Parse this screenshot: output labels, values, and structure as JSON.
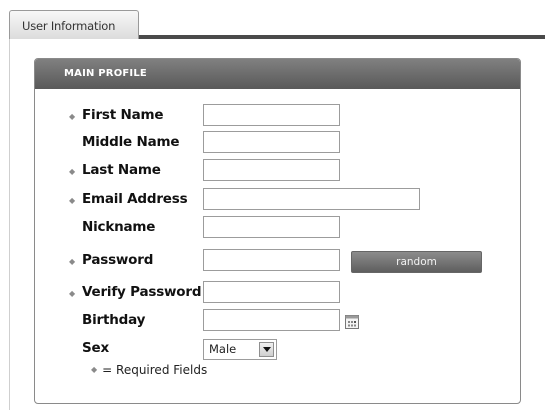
{
  "tabs": [
    {
      "label": "User Information"
    }
  ],
  "panel": {
    "title": "MAIN PROFILE"
  },
  "form": {
    "required_symbol": "◆",
    "fields": {
      "first_name": {
        "label": "First Name",
        "value": ""
      },
      "middle_name": {
        "label": "Middle Name",
        "value": ""
      },
      "last_name": {
        "label": "Last Name",
        "value": ""
      },
      "email": {
        "label": "Email Address",
        "value": ""
      },
      "nickname": {
        "label": "Nickname",
        "value": ""
      },
      "password": {
        "label": "Password",
        "value": ""
      },
      "verify_password": {
        "label": "Verify Password",
        "value": ""
      },
      "birthday": {
        "label": "Birthday",
        "value": ""
      },
      "sex": {
        "label": "Sex",
        "selected": "Male"
      }
    },
    "random_button": "random",
    "required_note": "= Required Fields"
  },
  "icons": {
    "calendar": "calendar-icon",
    "dropdown": "chevron-down-icon",
    "required": "required-marker-icon"
  },
  "colors": {
    "header_bg": "#6b6b6b",
    "tab_rule": "#4a4a4a",
    "button_bg": "#747474"
  }
}
